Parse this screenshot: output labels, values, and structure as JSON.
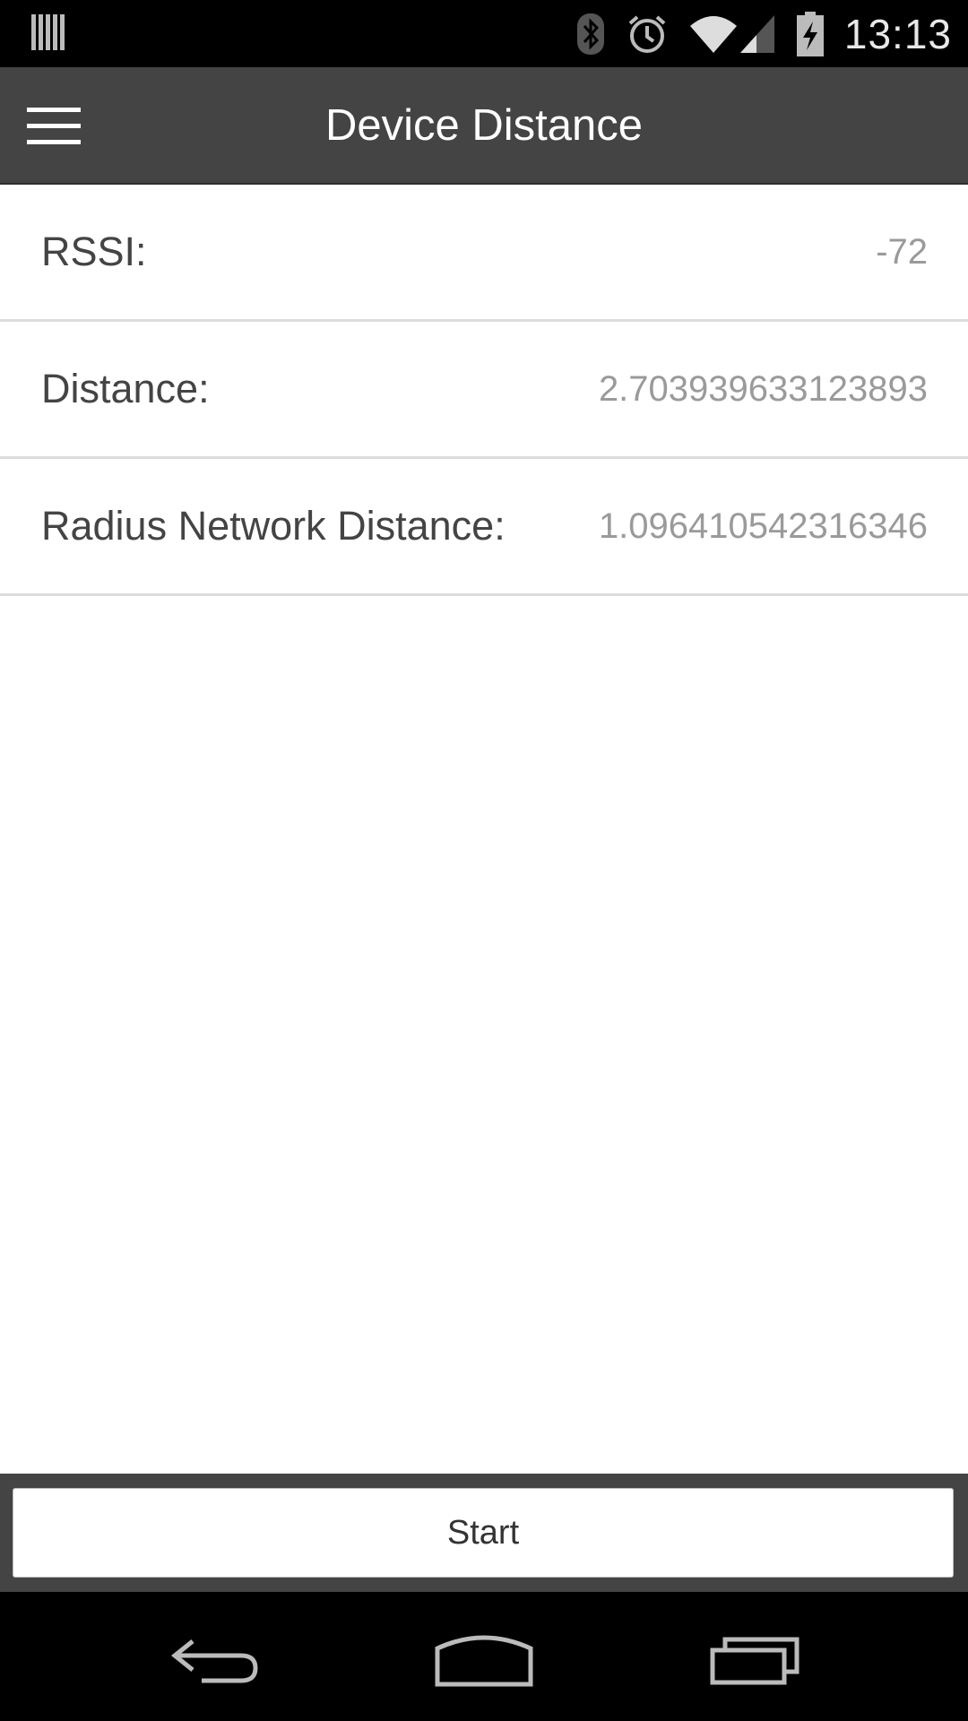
{
  "status_bar": {
    "time": "13:13",
    "icons": [
      "notification-bars-icon",
      "bluetooth-icon",
      "alarm-icon",
      "wifi-icon",
      "cell-signal-icon",
      "battery-charging-icon"
    ]
  },
  "app_bar": {
    "title": "Device Distance",
    "menu_icon": "hamburger-menu-icon"
  },
  "rows": [
    {
      "label": "RSSI:",
      "value": "-72"
    },
    {
      "label": "Distance:",
      "value": "2.703939633123893"
    },
    {
      "label": "Radius Network Distance:",
      "value": "1.096410542316346"
    }
  ],
  "actions": {
    "start_label": "Start"
  },
  "nav_bar": {
    "icons": [
      "back-icon",
      "home-icon",
      "recent-apps-icon"
    ]
  },
  "colors": {
    "app_bar": "#444444",
    "label_text": "#444444",
    "value_text": "#9a9a9a",
    "divider": "#dcdcdc"
  }
}
